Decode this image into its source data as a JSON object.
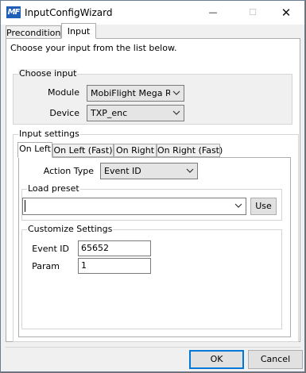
{
  "window": {
    "title": "InputConfigWizard",
    "icon_text": "MF",
    "controls": {
      "minimize": "—",
      "maximize": "☐",
      "close": "✕"
    }
  },
  "tabs": [
    {
      "label": "Precondition",
      "active": false
    },
    {
      "label": "Input",
      "active": true
    }
  ],
  "instruction": "Choose your input from the list below.",
  "choose_input": {
    "legend": "Choose input",
    "module_label": "Module",
    "module_value": "MobiFlight Mega RH",
    "device_label": "Device",
    "device_value": "TXP_enc"
  },
  "input_settings": {
    "legend": "Input settings",
    "sub_tabs": [
      {
        "label": "On Left",
        "active": true
      },
      {
        "label": "On Left (Fast)",
        "active": false
      },
      {
        "label": "On Right",
        "active": false
      },
      {
        "label": "On Right (Fast)",
        "active": false
      }
    ],
    "action_type_label": "Action Type",
    "action_type_value": "Event ID",
    "load_preset": {
      "legend": "Load preset",
      "value": "",
      "use_button": "Use"
    },
    "customize": {
      "legend": "Customize Settings",
      "event_id_label": "Event ID",
      "event_id_value": "65652",
      "param_label": "Param",
      "param_value": "1"
    }
  },
  "footer": {
    "ok_label": "OK",
    "cancel_label": "Cancel"
  },
  "colors": {
    "app_icon": "#1f5fb8",
    "window_bg": "#f0f0f0",
    "panel_bg": "#ffffff",
    "border": "#adadad"
  }
}
